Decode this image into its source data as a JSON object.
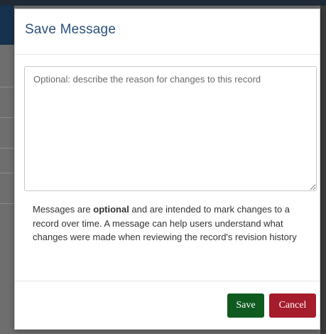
{
  "modal": {
    "title": "Save Message",
    "textarea": {
      "value": "",
      "placeholder": "Optional: describe the reason for changes to this record"
    },
    "help": {
      "before": "Messages are ",
      "emphasis": "optional",
      "after": " and are intended to mark changes to a record over time. A message can help users understand what changes were made when reviewing the record's revision history"
    },
    "buttons": {
      "save": "Save",
      "cancel": "Cancel"
    }
  },
  "colors": {
    "title": "#2a4f7a",
    "save_button": "#0e5a1f",
    "cancel_button": "#a51c2c"
  }
}
